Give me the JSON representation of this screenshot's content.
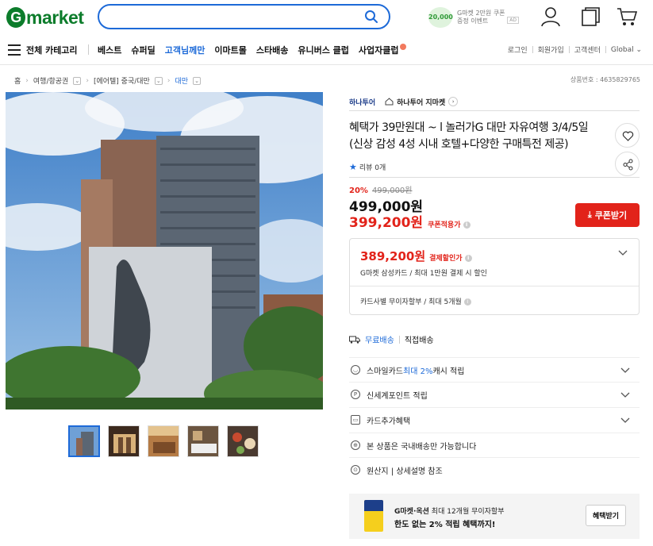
{
  "header": {
    "logo_g": "G",
    "logo_rest": "market",
    "search_placeholder": "",
    "promo": {
      "coin": "20,000",
      "line1": "G마켓 2만원 쿠폰",
      "line2": "증정 이벤트",
      "ad": "AD"
    }
  },
  "nav": {
    "all_categories": "전체 카테고리",
    "items": [
      "베스트",
      "슈퍼딜",
      "고객님께만",
      "이마트몰",
      "스타배송",
      "유니버스 클럽",
      "사업자클럽"
    ],
    "right": [
      "로그인",
      "회원가입",
      "고객센터",
      "Global"
    ]
  },
  "breadcrumb": {
    "items": [
      "홈",
      "여행/항공권",
      "[에어텔] 중국/대만",
      "대만"
    ],
    "item_no": "상품번호 : 4635829765"
  },
  "product": {
    "seller": "하나투어",
    "store": "하나투어 지마켓",
    "title": "혜택가 39만원대 ~ l 놀러가G 대만 자유여행 3/4/5일 (신상 감성 4성 시내 호텔+다양한 구매특전 제공)",
    "review": "리뷰 0개",
    "discount_pct": "20%",
    "orig_price": "499,000원",
    "price": "499,000원",
    "coupon_price": "399,200원",
    "coupon_label": "쿠폰적용가",
    "coupon_btn": "쿠폰받기"
  },
  "payment_box": {
    "price": "389,200원",
    "label": "결제할인가",
    "sub": "G마켓 삼성카드 / 최대 1만원 결제 시 할인",
    "installment": "카드사별 무이자할부 / 최대 5개월"
  },
  "shipping": {
    "free": "무료배송",
    "direct": "직접배송"
  },
  "rows": [
    {
      "pre": "스마일카드 ",
      "hl": "최대 2%",
      "post": " 캐시 적립",
      "icon": "smile-icon",
      "chev": true
    },
    {
      "pre": "신세계포인트 적립",
      "hl": "",
      "post": "",
      "icon": "point-icon",
      "chev": true
    },
    {
      "pre": "카드추가혜택",
      "hl": "",
      "post": "",
      "icon": "card-icon",
      "chev": true
    },
    {
      "pre": "본 상품은 국내배송만 가능합니다",
      "hl": "",
      "post": "",
      "icon": "globe-icon",
      "chev": false
    },
    {
      "pre": "원산지 | 상세설명 참조",
      "hl": "",
      "post": "",
      "icon": "origin-icon",
      "chev": false
    }
  ],
  "banner": {
    "line1_bold": "G마켓·옥션",
    "line1_rest": " 최대 12개월 무이자할부",
    "line2": "한도 없는 2% 적립 혜택까지!",
    "button": "혜택받기"
  },
  "colors": {
    "brand_green": "#0c7c2b",
    "accent_blue": "#1d6ad8",
    "sale_red": "#e2231a"
  }
}
